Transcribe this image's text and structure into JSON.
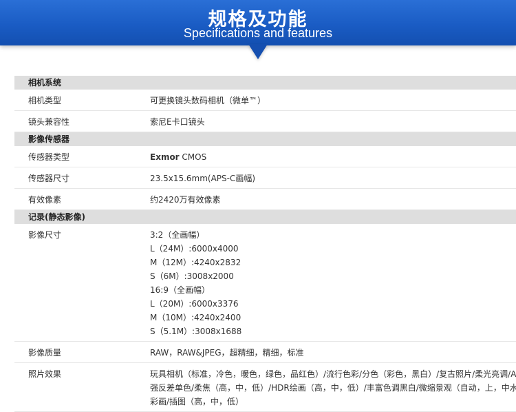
{
  "header": {
    "title": "规格及功能",
    "subtitle": "Specifications and features"
  },
  "sections": [
    {
      "title": "相机系统",
      "rows": [
        {
          "label": "相机类型",
          "lines": [
            "可更换镜头数码相机（微单™）"
          ]
        },
        {
          "label": "镜头兼容性",
          "lines": [
            "索尼E卡口镜头"
          ]
        }
      ]
    },
    {
      "title": "影像传感器",
      "rows": [
        {
          "label": "传感器类型",
          "brand": "Exmor",
          "lines": [
            " CMOS"
          ]
        },
        {
          "label": "传感器尺寸",
          "lines": [
            "23.5x15.6mm(APS-C画幅)"
          ]
        },
        {
          "label": "有效像素",
          "lines": [
            "约2420万有效像素"
          ]
        }
      ]
    },
    {
      "title": "记录(静态影像)",
      "rows": [
        {
          "label": "影像尺寸",
          "lines": [
            "3:2（全画幅）",
            "L（24M）:6000x4000",
            "M（12M）:4240x2832",
            "S（6M）:3008x2000",
            "16:9（全画幅）",
            "L（20M）:6000x3376",
            "M（10M）:4240x2400",
            "S（5.1M）:3008x1688"
          ]
        },
        {
          "label": "影像质量",
          "lines": [
            "RAW，RAW&JPEG，超精细，精细，标准"
          ]
        },
        {
          "label": "照片效果",
          "lines": [
            "玩具相机（标准，冷色，暖色，绿色，品红色）/流行色彩/分色（彩色，黑白）/复古照片/柔光亮调/A",
            "强反差单色/柔焦（高，中，低）/HDR绘画（高，中，低）/丰富色调黑白/微缩景观（自动，上，中水",
            "彩画/插图（高，中，低）"
          ]
        }
      ]
    }
  ]
}
